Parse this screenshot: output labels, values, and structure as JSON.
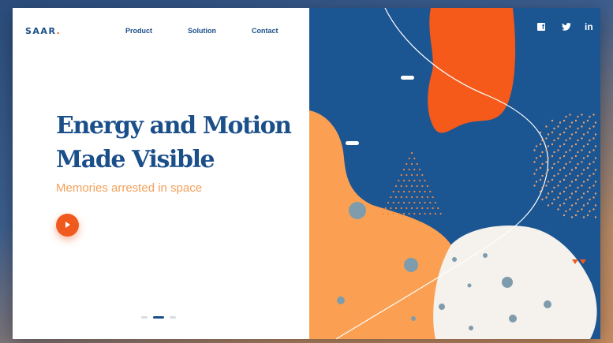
{
  "brand": {
    "name": "SAAR",
    "dot": "."
  },
  "nav": {
    "items": [
      "Product",
      "Solution",
      "Contact"
    ]
  },
  "hero": {
    "headline_line1": "Energy and Motion",
    "headline_line2": "Made Visible",
    "subtitle": "Memories arrested in space",
    "play_icon": "play-icon"
  },
  "slider": {
    "count": 3,
    "active_index": 1
  },
  "social": {
    "facebook": "f",
    "twitter": "twitter-icon",
    "linkedin": "in"
  },
  "colors": {
    "navy": "#1b4f8a",
    "panel_blue": "#1b5592",
    "orange_red": "#f05a1e",
    "peach": "#fba052",
    "cream": "#f5f1ec",
    "slate_dot": "#7f9cad",
    "accent_text": "#f4a05a"
  }
}
